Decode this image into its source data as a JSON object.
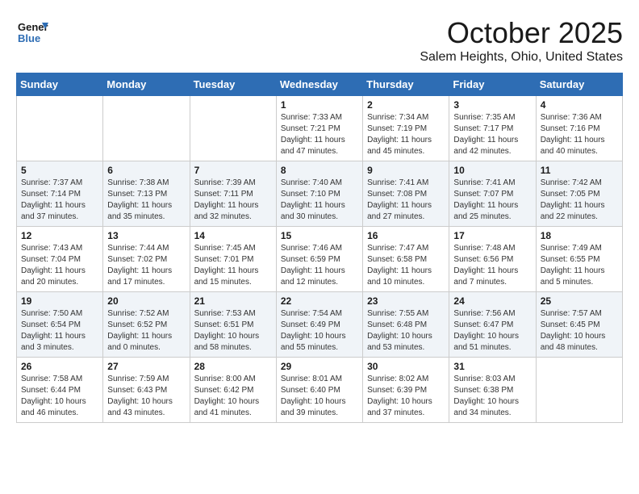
{
  "header": {
    "logo_line1": "General",
    "logo_line2": "Blue",
    "month_title": "October 2025",
    "location": "Salem Heights, Ohio, United States"
  },
  "days_of_week": [
    "Sunday",
    "Monday",
    "Tuesday",
    "Wednesday",
    "Thursday",
    "Friday",
    "Saturday"
  ],
  "weeks": [
    [
      {
        "day": "",
        "info": ""
      },
      {
        "day": "",
        "info": ""
      },
      {
        "day": "",
        "info": ""
      },
      {
        "day": "1",
        "info": "Sunrise: 7:33 AM\nSunset: 7:21 PM\nDaylight: 11 hours\nand 47 minutes."
      },
      {
        "day": "2",
        "info": "Sunrise: 7:34 AM\nSunset: 7:19 PM\nDaylight: 11 hours\nand 45 minutes."
      },
      {
        "day": "3",
        "info": "Sunrise: 7:35 AM\nSunset: 7:17 PM\nDaylight: 11 hours\nand 42 minutes."
      },
      {
        "day": "4",
        "info": "Sunrise: 7:36 AM\nSunset: 7:16 PM\nDaylight: 11 hours\nand 40 minutes."
      }
    ],
    [
      {
        "day": "5",
        "info": "Sunrise: 7:37 AM\nSunset: 7:14 PM\nDaylight: 11 hours\nand 37 minutes."
      },
      {
        "day": "6",
        "info": "Sunrise: 7:38 AM\nSunset: 7:13 PM\nDaylight: 11 hours\nand 35 minutes."
      },
      {
        "day": "7",
        "info": "Sunrise: 7:39 AM\nSunset: 7:11 PM\nDaylight: 11 hours\nand 32 minutes."
      },
      {
        "day": "8",
        "info": "Sunrise: 7:40 AM\nSunset: 7:10 PM\nDaylight: 11 hours\nand 30 minutes."
      },
      {
        "day": "9",
        "info": "Sunrise: 7:41 AM\nSunset: 7:08 PM\nDaylight: 11 hours\nand 27 minutes."
      },
      {
        "day": "10",
        "info": "Sunrise: 7:41 AM\nSunset: 7:07 PM\nDaylight: 11 hours\nand 25 minutes."
      },
      {
        "day": "11",
        "info": "Sunrise: 7:42 AM\nSunset: 7:05 PM\nDaylight: 11 hours\nand 22 minutes."
      }
    ],
    [
      {
        "day": "12",
        "info": "Sunrise: 7:43 AM\nSunset: 7:04 PM\nDaylight: 11 hours\nand 20 minutes."
      },
      {
        "day": "13",
        "info": "Sunrise: 7:44 AM\nSunset: 7:02 PM\nDaylight: 11 hours\nand 17 minutes."
      },
      {
        "day": "14",
        "info": "Sunrise: 7:45 AM\nSunset: 7:01 PM\nDaylight: 11 hours\nand 15 minutes."
      },
      {
        "day": "15",
        "info": "Sunrise: 7:46 AM\nSunset: 6:59 PM\nDaylight: 11 hours\nand 12 minutes."
      },
      {
        "day": "16",
        "info": "Sunrise: 7:47 AM\nSunset: 6:58 PM\nDaylight: 11 hours\nand 10 minutes."
      },
      {
        "day": "17",
        "info": "Sunrise: 7:48 AM\nSunset: 6:56 PM\nDaylight: 11 hours\nand 7 minutes."
      },
      {
        "day": "18",
        "info": "Sunrise: 7:49 AM\nSunset: 6:55 PM\nDaylight: 11 hours\nand 5 minutes."
      }
    ],
    [
      {
        "day": "19",
        "info": "Sunrise: 7:50 AM\nSunset: 6:54 PM\nDaylight: 11 hours\nand 3 minutes."
      },
      {
        "day": "20",
        "info": "Sunrise: 7:52 AM\nSunset: 6:52 PM\nDaylight: 11 hours\nand 0 minutes."
      },
      {
        "day": "21",
        "info": "Sunrise: 7:53 AM\nSunset: 6:51 PM\nDaylight: 10 hours\nand 58 minutes."
      },
      {
        "day": "22",
        "info": "Sunrise: 7:54 AM\nSunset: 6:49 PM\nDaylight: 10 hours\nand 55 minutes."
      },
      {
        "day": "23",
        "info": "Sunrise: 7:55 AM\nSunset: 6:48 PM\nDaylight: 10 hours\nand 53 minutes."
      },
      {
        "day": "24",
        "info": "Sunrise: 7:56 AM\nSunset: 6:47 PM\nDaylight: 10 hours\nand 51 minutes."
      },
      {
        "day": "25",
        "info": "Sunrise: 7:57 AM\nSunset: 6:45 PM\nDaylight: 10 hours\nand 48 minutes."
      }
    ],
    [
      {
        "day": "26",
        "info": "Sunrise: 7:58 AM\nSunset: 6:44 PM\nDaylight: 10 hours\nand 46 minutes."
      },
      {
        "day": "27",
        "info": "Sunrise: 7:59 AM\nSunset: 6:43 PM\nDaylight: 10 hours\nand 43 minutes."
      },
      {
        "day": "28",
        "info": "Sunrise: 8:00 AM\nSunset: 6:42 PM\nDaylight: 10 hours\nand 41 minutes."
      },
      {
        "day": "29",
        "info": "Sunrise: 8:01 AM\nSunset: 6:40 PM\nDaylight: 10 hours\nand 39 minutes."
      },
      {
        "day": "30",
        "info": "Sunrise: 8:02 AM\nSunset: 6:39 PM\nDaylight: 10 hours\nand 37 minutes."
      },
      {
        "day": "31",
        "info": "Sunrise: 8:03 AM\nSunset: 6:38 PM\nDaylight: 10 hours\nand 34 minutes."
      },
      {
        "day": "",
        "info": ""
      }
    ]
  ]
}
